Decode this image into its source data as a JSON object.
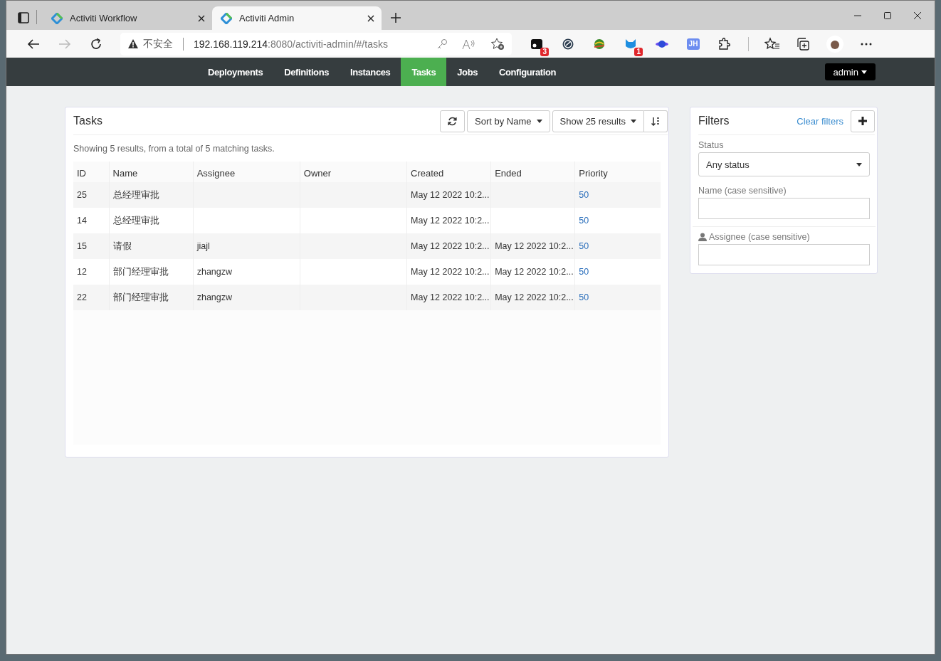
{
  "browser": {
    "tabs": [
      {
        "title": "Activiti Workflow",
        "selected": false
      },
      {
        "title": "Activiti Admin",
        "selected": true
      }
    ],
    "security": "不安全",
    "url_host": "192.168.119.214",
    "url_rest": ":8080/activiti-admin/#/tasks",
    "extensions": [
      {
        "kind": "square",
        "badge": "3"
      },
      {
        "kind": "ring"
      },
      {
        "kind": "globe"
      },
      {
        "kind": "cat",
        "badge": "1"
      },
      {
        "kind": "planet"
      },
      {
        "kind": "label",
        "label": "JH"
      }
    ]
  },
  "navbar": {
    "items": [
      {
        "label": "Deployments",
        "selected": false
      },
      {
        "label": "Definitions",
        "selected": false
      },
      {
        "label": "Instances",
        "selected": false
      },
      {
        "label": "Tasks",
        "selected": true
      },
      {
        "label": "Jobs",
        "selected": false
      },
      {
        "label": "Configuration",
        "selected": false
      }
    ],
    "user_menu": "admin"
  },
  "tasks": {
    "title": "Tasks",
    "sort": "Sort by Name",
    "page_size": "Show 25 results",
    "summary": "Showing 5 results, from a total of 5 matching tasks.",
    "columns": [
      "ID",
      "Name",
      "Assignee",
      "Owner",
      "Created",
      "Ended",
      "Priority"
    ],
    "rows": [
      [
        "25",
        "总经理审批",
        "",
        "",
        "May 12 2022 10:2...",
        "",
        "50"
      ],
      [
        "14",
        "总经理审批",
        "",
        "",
        "May 12 2022 10:2...",
        "",
        "50"
      ],
      [
        "15",
        "请假",
        "jiajl",
        "",
        "May 12 2022 10:2...",
        "May 12 2022 10:2...",
        "50"
      ],
      [
        "12",
        "部门经理审批",
        "zhangzw",
        "",
        "May 12 2022 10:2...",
        "May 12 2022 10:2...",
        "50"
      ],
      [
        "22",
        "部门经理审批",
        "zhangzw",
        "",
        "May 12 2022 10:2...",
        "May 12 2022 10:2...",
        "50"
      ]
    ]
  },
  "filters": {
    "title": "Filters",
    "clear": "Clear filters",
    "status_label": "Status",
    "status_value": "Any status",
    "name_label": "Name (case sensitive)",
    "assignee_label": "Assignee (case sensitive)"
  }
}
